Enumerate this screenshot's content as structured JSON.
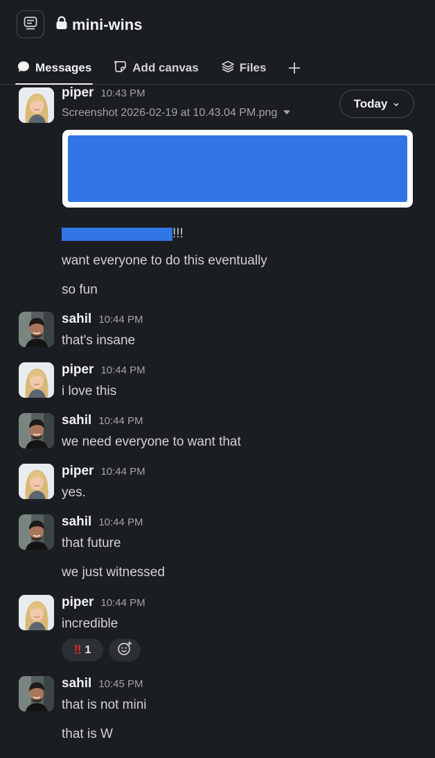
{
  "channel": {
    "name": "mini-wins"
  },
  "tabs": [
    {
      "label": "Messages",
      "icon": "chat-bubble-icon",
      "active": true
    },
    {
      "label": "Add canvas",
      "icon": "canvas-icon",
      "active": false
    },
    {
      "label": "Files",
      "icon": "layers-icon",
      "active": false
    }
  ],
  "date_divider": {
    "label": "Today"
  },
  "colors": {
    "background": "#1a1d21",
    "redaction": "#3275e6",
    "reaction_alert": "#e0292b"
  },
  "messages": [
    {
      "author": "piper",
      "time": "10:43 PM",
      "file_name": "Screenshot 2026-02-19 at 10.43.04 PM.png",
      "lines": [
        "!!!",
        "want everyone to do this eventually",
        "so fun"
      ]
    },
    {
      "author": "sahil",
      "time": "10:44 PM",
      "lines": [
        "that's insane"
      ]
    },
    {
      "author": "piper",
      "time": "10:44 PM",
      "lines": [
        "i love this"
      ]
    },
    {
      "author": "sahil",
      "time": "10:44 PM",
      "lines": [
        "we need everyone to want that"
      ]
    },
    {
      "author": "piper",
      "time": "10:44 PM",
      "lines": [
        "yes."
      ]
    },
    {
      "author": "sahil",
      "time": "10:44 PM",
      "lines": [
        "that future",
        "we just witnessed"
      ]
    },
    {
      "author": "piper",
      "time": "10:44 PM",
      "lines": [
        "incredible"
      ],
      "reactions": [
        {
          "emoji": "!!",
          "count": "1"
        }
      ]
    },
    {
      "author": "sahil",
      "time": "10:45 PM",
      "lines": [
        "that is not mini",
        "that is W"
      ]
    }
  ]
}
